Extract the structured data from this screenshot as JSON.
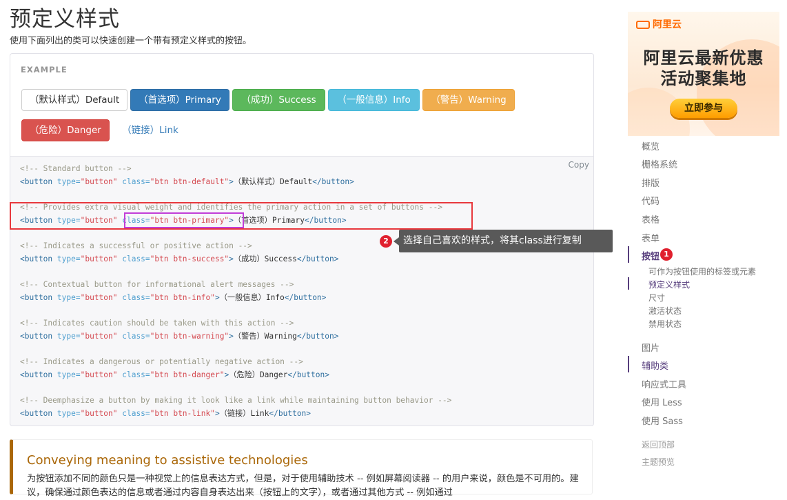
{
  "page": {
    "title": "预定义样式",
    "intro": "使用下面列出的类可以快速创建一个带有预定义样式的按钮。"
  },
  "example": {
    "label": "EXAMPLE",
    "buttons": {
      "default": "（默认样式）Default",
      "primary": "（首选项）Primary",
      "success": "（成功）Success",
      "info": "（一般信息）Info",
      "warning": "（警告）Warning",
      "danger": "（危险）Danger",
      "link": "（链接）Link"
    }
  },
  "code": {
    "copy_label": "Copy",
    "blocks": [
      {
        "comment": "<!-- Standard button -->",
        "class": "btn btn-default",
        "text": "（默认样式）Default"
      },
      {
        "comment": "<!-- Provides extra visual weight and identifies the primary action in a set of buttons -->",
        "class": "btn btn-primary",
        "text": "（首选项）Primary"
      },
      {
        "comment": "<!-- Indicates a successful or positive action -->",
        "class": "btn btn-success",
        "text": "（成功）Success"
      },
      {
        "comment": "<!-- Contextual button for informational alert messages -->",
        "class": "btn btn-info",
        "text": "（一般信息）Info"
      },
      {
        "comment": "<!-- Indicates caution should be taken with this action -->",
        "class": "btn btn-warning",
        "text": "（警告）Warning"
      },
      {
        "comment": "<!-- Indicates a dangerous or potentially negative action -->",
        "class": "btn btn-danger",
        "text": "（危险）Danger"
      },
      {
        "comment": "<!-- Deemphasize a button by making it look like a link while maintaining button behavior -->",
        "class": "btn btn-link",
        "text": "（链接）Link"
      }
    ],
    "tokens": {
      "open_tag": "<button",
      "type_attr": "type=",
      "type_val": "\"button\"",
      "class_attr": "class=",
      "close_bracket": ">",
      "close_tag": "</button>"
    }
  },
  "annotation": {
    "badge1": "1",
    "badge2": "2",
    "tooltip": "选择自己喜欢的样式，将其class进行复制",
    "highlight_color": "#e8383d",
    "class_highlight_color": "#c13dd8"
  },
  "callout": {
    "title": "Conveying meaning to assistive technologies",
    "body": "为按钮添加不同的颜色只是一种视觉上的信息表达方式，但是，对于使用辅助技术 -- 例如屏幕阅读器 -- 的用户来说，颜色是不可用的。建议，确保通过颜色表达的信息或者通过内容自身表达出来（按钮上的文字），或者通过其他方式 -- 例如通过"
  },
  "ad": {
    "brand": "阿里云",
    "line1": "阿里云最新优惠",
    "line2": "活动聚集地",
    "cta": "立即参与"
  },
  "sidebar": {
    "items": [
      "概览",
      "栅格系统",
      "排版",
      "代码",
      "表格",
      "表单",
      "按钮"
    ],
    "sub_items": [
      "可作为按钮使用的标签或元素",
      "预定义样式",
      "尺寸",
      "激活状态",
      "禁用状态"
    ],
    "items_after": [
      "图片",
      "辅助类",
      "响应式工具",
      "使用 Less",
      "使用 Sass"
    ],
    "meta": [
      "返回顶部",
      "主题预览"
    ]
  }
}
